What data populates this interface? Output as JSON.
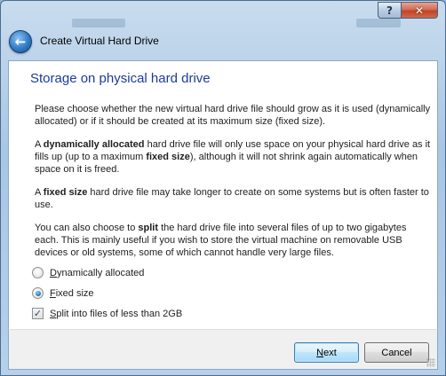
{
  "window": {
    "title": "Create Virtual Hard Drive",
    "help_glyph": "?",
    "close_glyph": "✕",
    "back_glyph": "←"
  },
  "page": {
    "heading": "Storage on physical hard drive",
    "paragraphs": {
      "p1": "Please choose whether the new virtual hard drive file should grow as it is used (dynamically allocated) or if it should be created at its maximum size (fixed size).",
      "p2_a": "A ",
      "p2_b": "dynamically allocated",
      "p2_c": " hard drive file will only use space on your physical hard drive as it fills up (up to a maximum ",
      "p2_d": "fixed size",
      "p2_e": "), although it will not shrink again automatically when space on it is freed.",
      "p3_a": "A ",
      "p3_b": "fixed size",
      "p3_c": " hard drive file may take longer to create on some systems but is often faster to use.",
      "p4_a": "You can also choose to ",
      "p4_b": "split",
      "p4_c": " the hard drive file into several files of up to two gigabytes each. This is mainly useful if you wish to store the virtual machine on removable USB devices or old systems, some of which cannot handle very large files."
    },
    "options": {
      "dynamic": {
        "mnemonic": "D",
        "rest": "ynamically allocated",
        "selected": false
      },
      "fixed": {
        "mnemonic": "F",
        "rest": "ixed size",
        "selected": true
      },
      "split": {
        "mnemonic": "S",
        "rest": "plit into files of less than 2GB",
        "checked": true,
        "check_glyph": "✓"
      }
    }
  },
  "buttons": {
    "next": {
      "mnemonic": "N",
      "rest": "ext"
    },
    "cancel": {
      "label": "Cancel"
    }
  },
  "colors": {
    "heading": "#1a3b9a",
    "frame": "#a9c6e2",
    "close": "#c0432a",
    "default_button_border": "#3c7fb1"
  }
}
